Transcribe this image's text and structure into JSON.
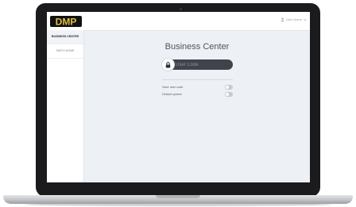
{
  "header": {
    "logo_text": "DMP",
    "user_label": "User Name"
  },
  "sidebar": {
    "items": [
      {
        "label": "BUSINESS CENTER"
      },
      {
        "label": "SMITH HOME"
      }
    ]
  },
  "main": {
    "title": "Business Center",
    "user_code_placeholder": "User Code",
    "options": [
      {
        "label": "Save user code",
        "enabled": false
      },
      {
        "label": "Default system",
        "enabled": false
      }
    ]
  },
  "colors": {
    "logo_gold": "#e0bf45",
    "logo_bg": "#111111",
    "pill_bg": "#3f444c",
    "screen_bg": "#edf0f4"
  },
  "icons": [
    "lock-icon",
    "user-icon",
    "chevron-down-icon",
    "camera-icon"
  ]
}
